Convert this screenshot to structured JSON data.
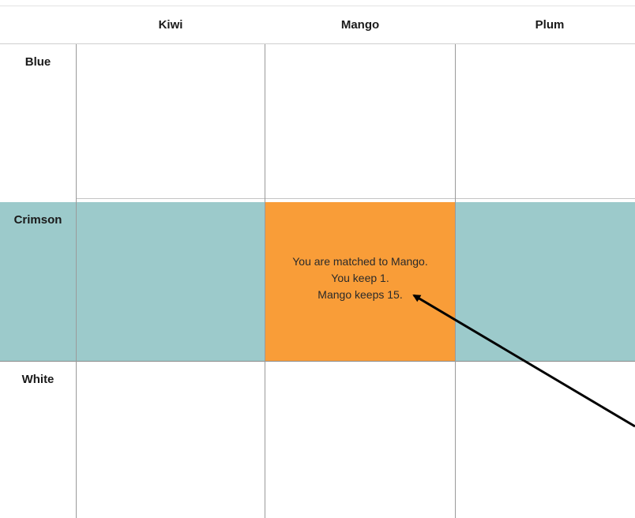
{
  "columns": [
    {
      "label": "Kiwi"
    },
    {
      "label": "Mango"
    },
    {
      "label": "Plum"
    }
  ],
  "rows": [
    {
      "label": "Blue",
      "highlighted": false
    },
    {
      "label": "Crimson",
      "highlighted": true,
      "band_color": "#9ccacb"
    },
    {
      "label": "White",
      "highlighted": false
    }
  ],
  "selected_cell": {
    "row": "Crimson",
    "column": "Mango",
    "color": "#f99d38",
    "lines": [
      "You are matched to Mango.",
      "You keep 1.",
      "Mango keeps 15."
    ]
  },
  "annotation": {
    "type": "arrow",
    "color": "#000000",
    "points_to": "selected-cell-text"
  }
}
